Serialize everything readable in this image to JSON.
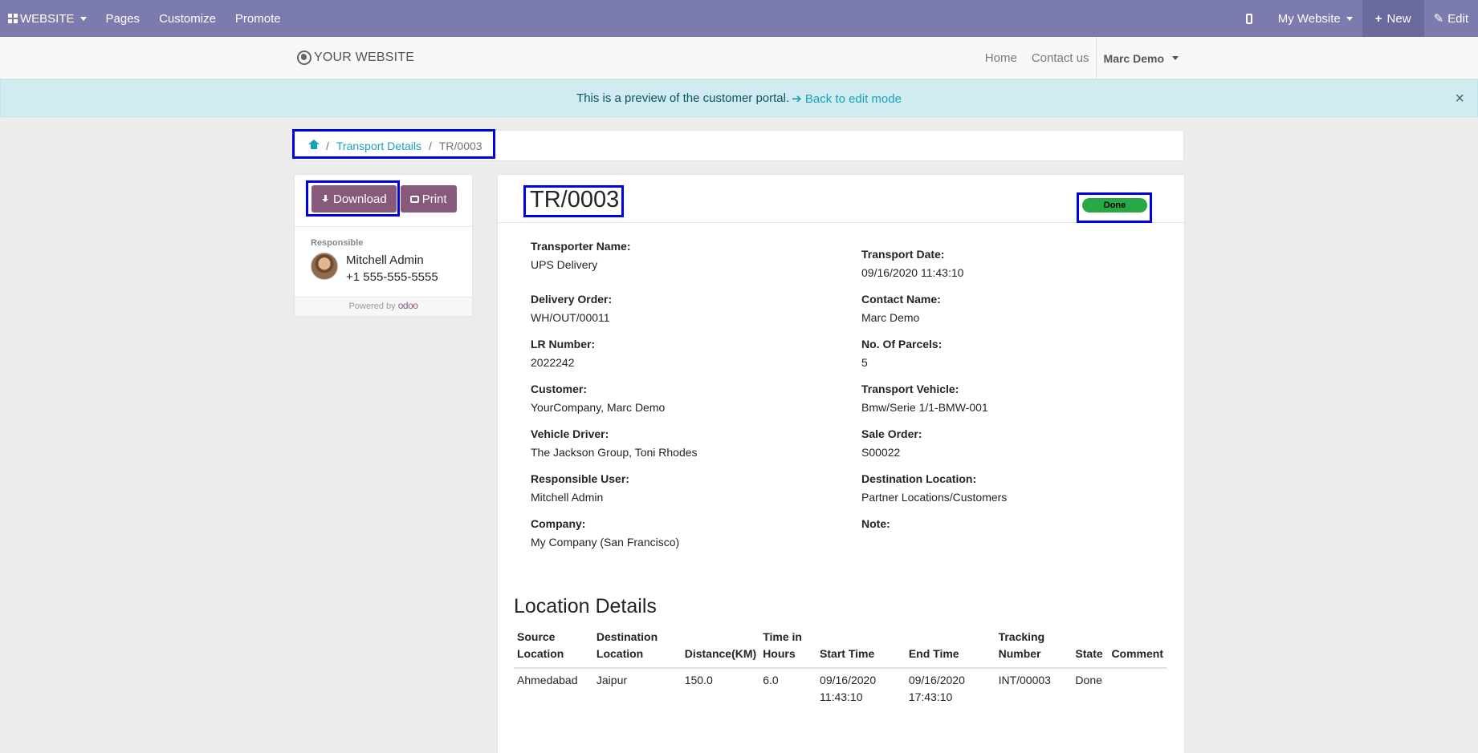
{
  "topbar": {
    "app_menu": "WEBSITE",
    "pages": "Pages",
    "customize": "Customize",
    "promote": "Promote",
    "website_select": "My Website",
    "new_label": "New",
    "edit_label": "Edit"
  },
  "site": {
    "logo_text": "YOUR WEBSITE",
    "nav_home": "Home",
    "nav_contact": "Contact us",
    "user_name": "Marc Demo"
  },
  "alert": {
    "message": "This is a preview of the customer portal.",
    "link": "Back to edit mode",
    "close": "×"
  },
  "breadcrumb": {
    "sep": "/",
    "parent": "Transport Details",
    "current": "TR/0003"
  },
  "sidebar": {
    "download_label": "Download",
    "print_label": "Print",
    "responsible_label": "Responsible",
    "responsible_name": "Mitchell Admin",
    "responsible_phone": "+1 555-555-5555",
    "powered_by": "Powered by",
    "odoo": "odoo"
  },
  "document": {
    "title": "TR/0003",
    "status": "Done",
    "status_color": "#28a745",
    "fields_left": [
      {
        "label": "Transporter Name:",
        "value": "UPS Delivery"
      },
      {
        "label": "Delivery Order:",
        "value": "WH/OUT/00011"
      },
      {
        "label": "LR Number:",
        "value": "2022242"
      },
      {
        "label": "Customer:",
        "value": "YourCompany, Marc Demo"
      },
      {
        "label": "Vehicle Driver:",
        "value": "The Jackson Group, Toni Rhodes"
      },
      {
        "label": "Responsible User:",
        "value": "Mitchell Admin"
      },
      {
        "label": "Company:",
        "value": "My Company (San Francisco)"
      }
    ],
    "fields_right": [
      {
        "label": "Transport Date:",
        "value": "09/16/2020 11:43:10"
      },
      {
        "label": "Contact Name:",
        "value": "Marc Demo"
      },
      {
        "label": "No. Of Parcels:",
        "value": "5"
      },
      {
        "label": "Transport Vehicle:",
        "value": "Bmw/Serie 1/1-BMW-001"
      },
      {
        "label": "Sale Order:",
        "value": "S00022"
      },
      {
        "label": "Destination Location:",
        "value": "Partner Locations/Customers"
      },
      {
        "label": "Note:",
        "value": ""
      }
    ]
  },
  "locations": {
    "title": "Location Details",
    "columns": [
      "Source Location",
      "Destination Location",
      "Distance(KM)",
      "Time in Hours",
      "Start Time",
      "End Time",
      "Tracking Number",
      "State",
      "Comment"
    ],
    "rows": [
      [
        "Ahmedabad",
        "Jaipur",
        "150.0",
        "6.0",
        "09/16/2020 11:43:10",
        "09/16/2020 17:43:10",
        "INT/00003",
        "Done",
        ""
      ]
    ]
  },
  "colors": {
    "topbar": "#7c7bad",
    "primary_button": "#875a7b",
    "link": "#17a2b8",
    "highlight_box": "#0000e6"
  }
}
